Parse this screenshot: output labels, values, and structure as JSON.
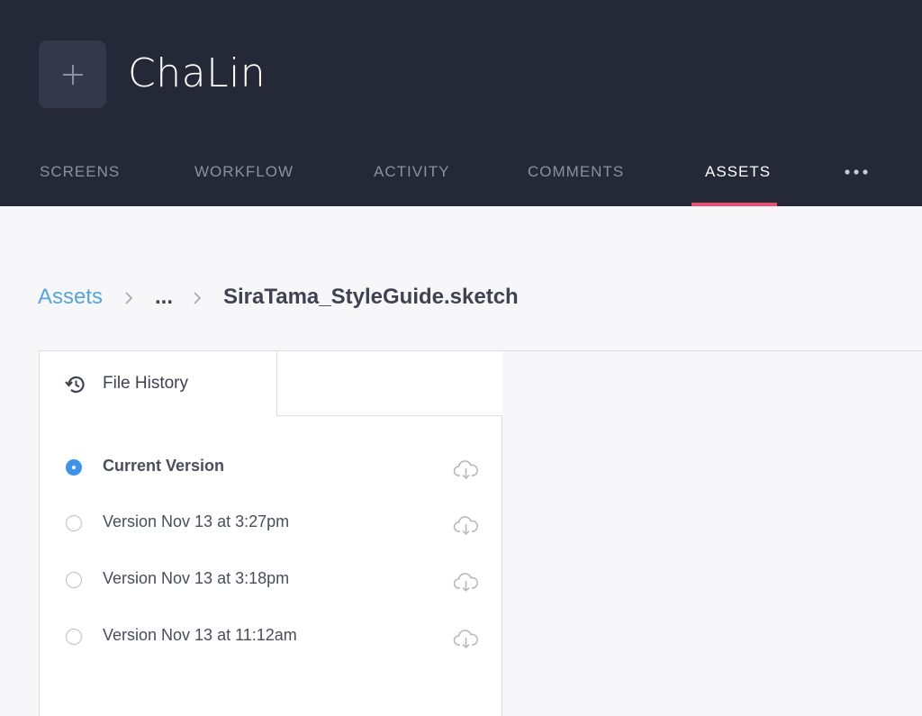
{
  "project": {
    "title": "ChaLin",
    "logo_icon": "plus-icon"
  },
  "nav": {
    "tabs": [
      {
        "label": "SCREENS",
        "active": false
      },
      {
        "label": "WORKFLOW",
        "active": false
      },
      {
        "label": "ACTIVITY",
        "active": false
      },
      {
        "label": "COMMENTS",
        "active": false
      },
      {
        "label": "ASSETS",
        "active": true
      }
    ],
    "more_icon": "more-horizontal-icon",
    "accent_color": "#e9506d"
  },
  "breadcrumb": {
    "root": "Assets",
    "middle": "...",
    "current": "SiraTama_StyleGuide.sketch"
  },
  "file_history": {
    "tab_label": "File History",
    "tab_icon": "history-icon",
    "versions": [
      {
        "label": "Current Version",
        "selected": true
      },
      {
        "label": "Version Nov 13 at 3:27pm",
        "selected": false
      },
      {
        "label": "Version Nov 13 at 3:18pm",
        "selected": false
      },
      {
        "label": "Version Nov 13 at 11:12am",
        "selected": false
      }
    ],
    "download_icon": "cloud-download-icon",
    "selected_color": "#3e93e6"
  },
  "colors": {
    "header_bg": "#242837",
    "link": "#54a6da"
  }
}
